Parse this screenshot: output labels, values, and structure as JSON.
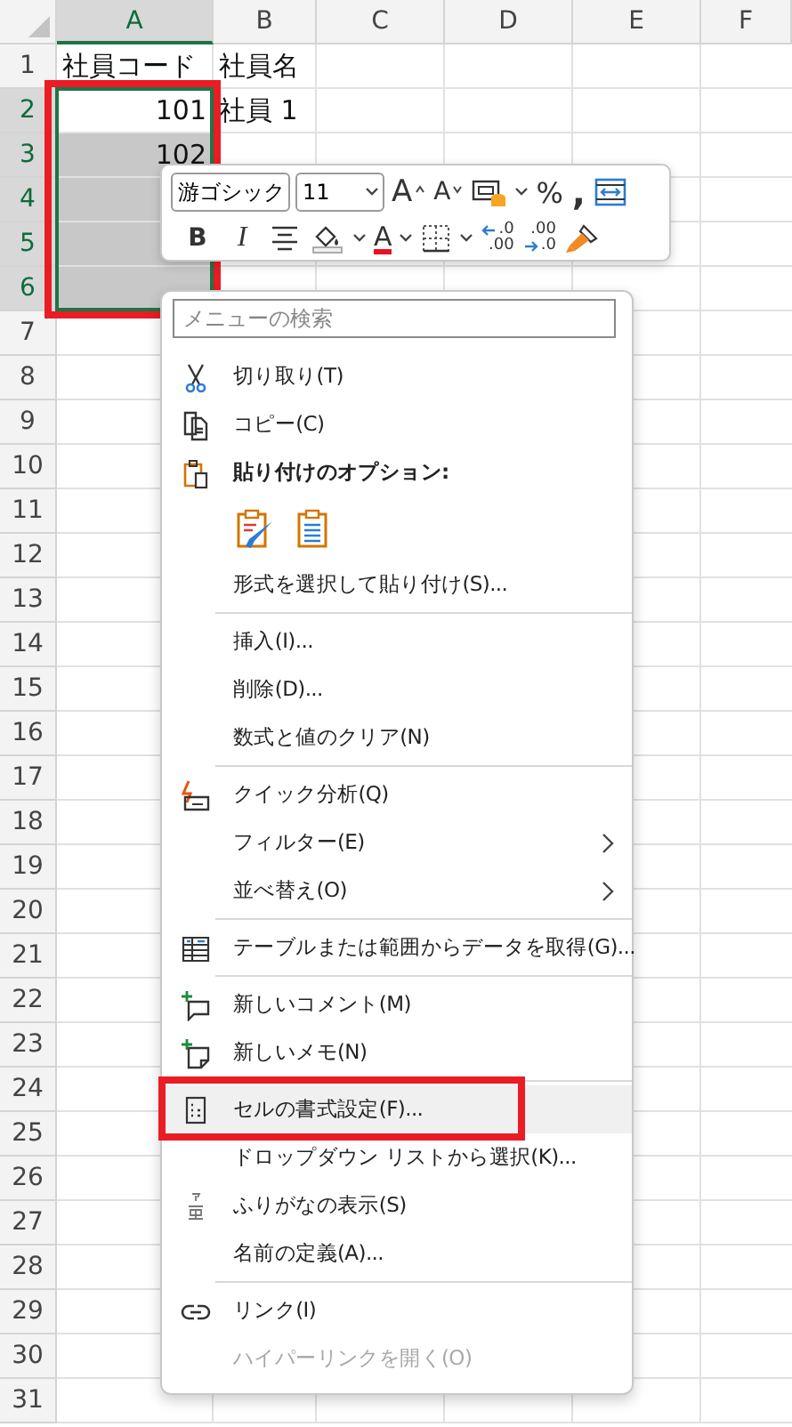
{
  "sheet": {
    "selection_boxed": true,
    "columns": [
      {
        "label": "A",
        "selected": true
      },
      {
        "label": "B",
        "selected": false
      },
      {
        "label": "C",
        "selected": false
      },
      {
        "label": "D",
        "selected": false
      },
      {
        "label": "E",
        "selected": false
      },
      {
        "label": "F",
        "selected": false
      }
    ],
    "rows": [
      {
        "number": "1",
        "selected": false,
        "cells": [
          {
            "text": "社員コード",
            "kind": "text",
            "selected": false,
            "active": false
          },
          {
            "text": "社員名",
            "kind": "text",
            "selected": false,
            "active": false
          }
        ]
      },
      {
        "number": "2",
        "selected": true,
        "cells": [
          {
            "text": "101",
            "kind": "number",
            "selected": true,
            "active": true
          },
          {
            "text": "社員 1",
            "kind": "text",
            "selected": false,
            "active": false
          }
        ]
      },
      {
        "number": "3",
        "selected": true,
        "cells": [
          {
            "text": "102",
            "kind": "number",
            "selected": true,
            "active": false
          }
        ]
      },
      {
        "number": "4",
        "selected": true,
        "cells": [
          {
            "kind": "text",
            "selected": true,
            "active": false
          }
        ]
      },
      {
        "number": "5",
        "selected": true,
        "cells": [
          {
            "kind": "text",
            "selected": true,
            "active": false
          }
        ]
      },
      {
        "number": "6",
        "selected": true,
        "cells": [
          {
            "kind": "number",
            "selected": true,
            "active": false
          }
        ]
      },
      {
        "number": "7",
        "selected": false
      },
      {
        "number": "8",
        "selected": false
      },
      {
        "number": "9",
        "selected": false
      },
      {
        "number": "10",
        "selected": false
      },
      {
        "number": "11",
        "selected": false
      },
      {
        "number": "12",
        "selected": false
      },
      {
        "number": "13",
        "selected": false
      },
      {
        "number": "14",
        "selected": false
      },
      {
        "number": "15",
        "selected": false
      },
      {
        "number": "16",
        "selected": false
      },
      {
        "number": "17",
        "selected": false
      },
      {
        "number": "18",
        "selected": false
      },
      {
        "number": "19",
        "selected": false
      },
      {
        "number": "20",
        "selected": false
      },
      {
        "number": "21",
        "selected": false
      },
      {
        "number": "22",
        "selected": false
      },
      {
        "number": "23",
        "selected": false
      },
      {
        "number": "24",
        "selected": false
      },
      {
        "number": "25",
        "selected": false
      },
      {
        "number": "26",
        "selected": false
      },
      {
        "number": "27",
        "selected": false
      },
      {
        "number": "28",
        "selected": false
      },
      {
        "number": "29",
        "selected": false
      },
      {
        "number": "30",
        "selected": false
      },
      {
        "number": "31",
        "selected": false
      }
    ]
  },
  "mini_toolbar": {
    "font": "游ゴシック",
    "size": "11",
    "rows": [
      [
        {
          "kind": "grow-font",
          "label": "A",
          "dropdown": false
        },
        {
          "kind": "shrink-font",
          "label": "A",
          "dropdown": false
        },
        {
          "kind": "accounting",
          "dropdown": true
        },
        {
          "kind": "percent",
          "label": "%",
          "dropdown": false
        },
        {
          "kind": "comma",
          "label": ",",
          "dropdown": false
        },
        {
          "kind": "wrap",
          "dropdown": false
        }
      ],
      [
        {
          "kind": "bold",
          "label": "B",
          "dropdown": false
        },
        {
          "kind": "italic",
          "label": "I",
          "dropdown": false
        },
        {
          "kind": "center",
          "dropdown": false
        },
        {
          "kind": "fill-color",
          "dropdown": true
        },
        {
          "kind": "font-color",
          "label": "A",
          "dropdown": true
        },
        {
          "kind": "borders",
          "dropdown": true
        },
        {
          "kind": "increase-decimal",
          "labels": [
            ".0",
            ".00"
          ],
          "dropdown": false
        },
        {
          "kind": "decrease-decimal",
          "labels": [
            ".00",
            ".0"
          ],
          "dropdown": false
        },
        {
          "kind": "format-painter",
          "dropdown": false
        }
      ]
    ]
  },
  "menu": {
    "items": [
      {
        "kind": "search",
        "placeholder": "メニューの検索"
      },
      {
        "kind": "item",
        "label": "切り取り(T)",
        "submenu": false,
        "disabled": false,
        "highlighted": false,
        "boxed": false
      },
      {
        "kind": "item",
        "label": "コピー(C)",
        "submenu": false,
        "disabled": false,
        "highlighted": false,
        "boxed": false
      },
      {
        "kind": "heading",
        "label": "貼り付けのオプション:"
      },
      {
        "kind": "paste-options"
      },
      {
        "kind": "item",
        "label": "形式を選択して貼り付け(S)...",
        "submenu": false,
        "disabled": false,
        "highlighted": false,
        "boxed": false
      },
      {
        "kind": "separator"
      },
      {
        "kind": "item",
        "label": "挿入(I)...",
        "submenu": false,
        "disabled": false,
        "highlighted": false,
        "boxed": false
      },
      {
        "kind": "item",
        "label": "削除(D)...",
        "submenu": false,
        "disabled": false,
        "highlighted": false,
        "boxed": false
      },
      {
        "kind": "item",
        "label": "数式と値のクリア(N)",
        "submenu": false,
        "disabled": false,
        "highlighted": false,
        "boxed": false
      },
      {
        "kind": "separator"
      },
      {
        "kind": "item",
        "label": "クイック分析(Q)",
        "submenu": false,
        "disabled": false,
        "highlighted": false,
        "boxed": false
      },
      {
        "kind": "item",
        "label": "フィルター(E)",
        "submenu": true,
        "disabled": false,
        "highlighted": false,
        "boxed": false
      },
      {
        "kind": "item",
        "label": "並べ替え(O)",
        "submenu": true,
        "disabled": false,
        "highlighted": false,
        "boxed": false
      },
      {
        "kind": "separator"
      },
      {
        "kind": "item",
        "label": "テーブルまたは範囲からデータを取得(G)...",
        "submenu": false,
        "disabled": false,
        "highlighted": false,
        "boxed": false
      },
      {
        "kind": "separator"
      },
      {
        "kind": "item",
        "label": "新しいコメント(M)",
        "submenu": false,
        "disabled": false,
        "highlighted": false,
        "boxed": false
      },
      {
        "kind": "item",
        "label": "新しいメモ(N)",
        "submenu": false,
        "disabled": false,
        "highlighted": false,
        "boxed": false
      },
      {
        "kind": "separator"
      },
      {
        "kind": "item",
        "label": "セルの書式設定(F)...",
        "submenu": false,
        "disabled": false,
        "highlighted": true,
        "boxed": true
      },
      {
        "kind": "item",
        "label": "ドロップダウン リストから選択(K)...",
        "submenu": false,
        "disabled": false,
        "highlighted": false,
        "boxed": false
      },
      {
        "kind": "item",
        "label": "ふりがなの表示(S)",
        "submenu": false,
        "disabled": false,
        "highlighted": false,
        "boxed": false
      },
      {
        "kind": "item",
        "label": "名前の定義(A)...",
        "submenu": false,
        "disabled": false,
        "highlighted": false,
        "boxed": false
      },
      {
        "kind": "separator"
      },
      {
        "kind": "item",
        "label": "リンク(I)",
        "submenu": false,
        "disabled": false,
        "highlighted": false,
        "boxed": false
      },
      {
        "kind": "item",
        "label": "ハイパーリンクを開く(O)",
        "submenu": false,
        "disabled": true,
        "highlighted": false,
        "boxed": false
      }
    ]
  }
}
